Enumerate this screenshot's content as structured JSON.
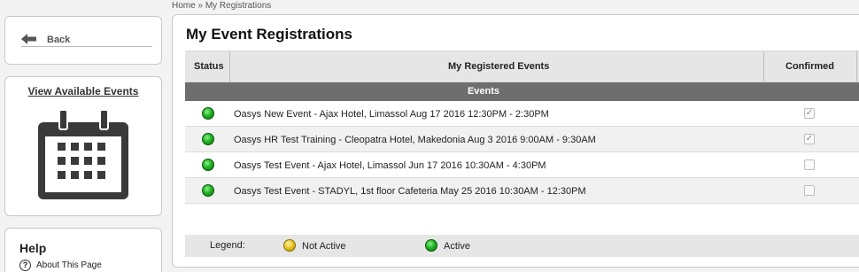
{
  "breadcrumb": {
    "home": "Home",
    "separator": "»",
    "current": "My Registrations"
  },
  "sidebar": {
    "back_label": "Back",
    "view_events_label": "View Available Events",
    "help_title": "Help",
    "about_label": "About This Page"
  },
  "main": {
    "title": "My Event Registrations",
    "columns": {
      "status": "Status",
      "events": "My Registered Events",
      "confirmed": "Confirmed"
    },
    "group_label": "Events",
    "rows": [
      {
        "status": "Active",
        "event": "Oasys New Event - Ajax Hotel, Limassol Aug 17 2016 12:30PM - 2:30PM",
        "confirmed": true
      },
      {
        "status": "Active",
        "event": "Oasys HR Test Training - Cleopatra Hotel, Makedonia Aug 3 2016 9:00AM - 9:30AM",
        "confirmed": true
      },
      {
        "status": "Active",
        "event": "Oasys Test Event - Ajax Hotel, Limassol Jun 17 2016 10:30AM - 4:30PM",
        "confirmed": false
      },
      {
        "status": "Active",
        "event": "Oasys Test Event - STADYL, 1st floor Cafeteria May 25 2016 10:30AM - 12:30PM",
        "confirmed": false
      }
    ],
    "legend": {
      "label": "Legend:",
      "not_active": "Not Active",
      "active": "Active"
    }
  },
  "colors": {
    "active": "#22b322",
    "not_active": "#e6c21f",
    "group_header": "#6e6e6e"
  }
}
